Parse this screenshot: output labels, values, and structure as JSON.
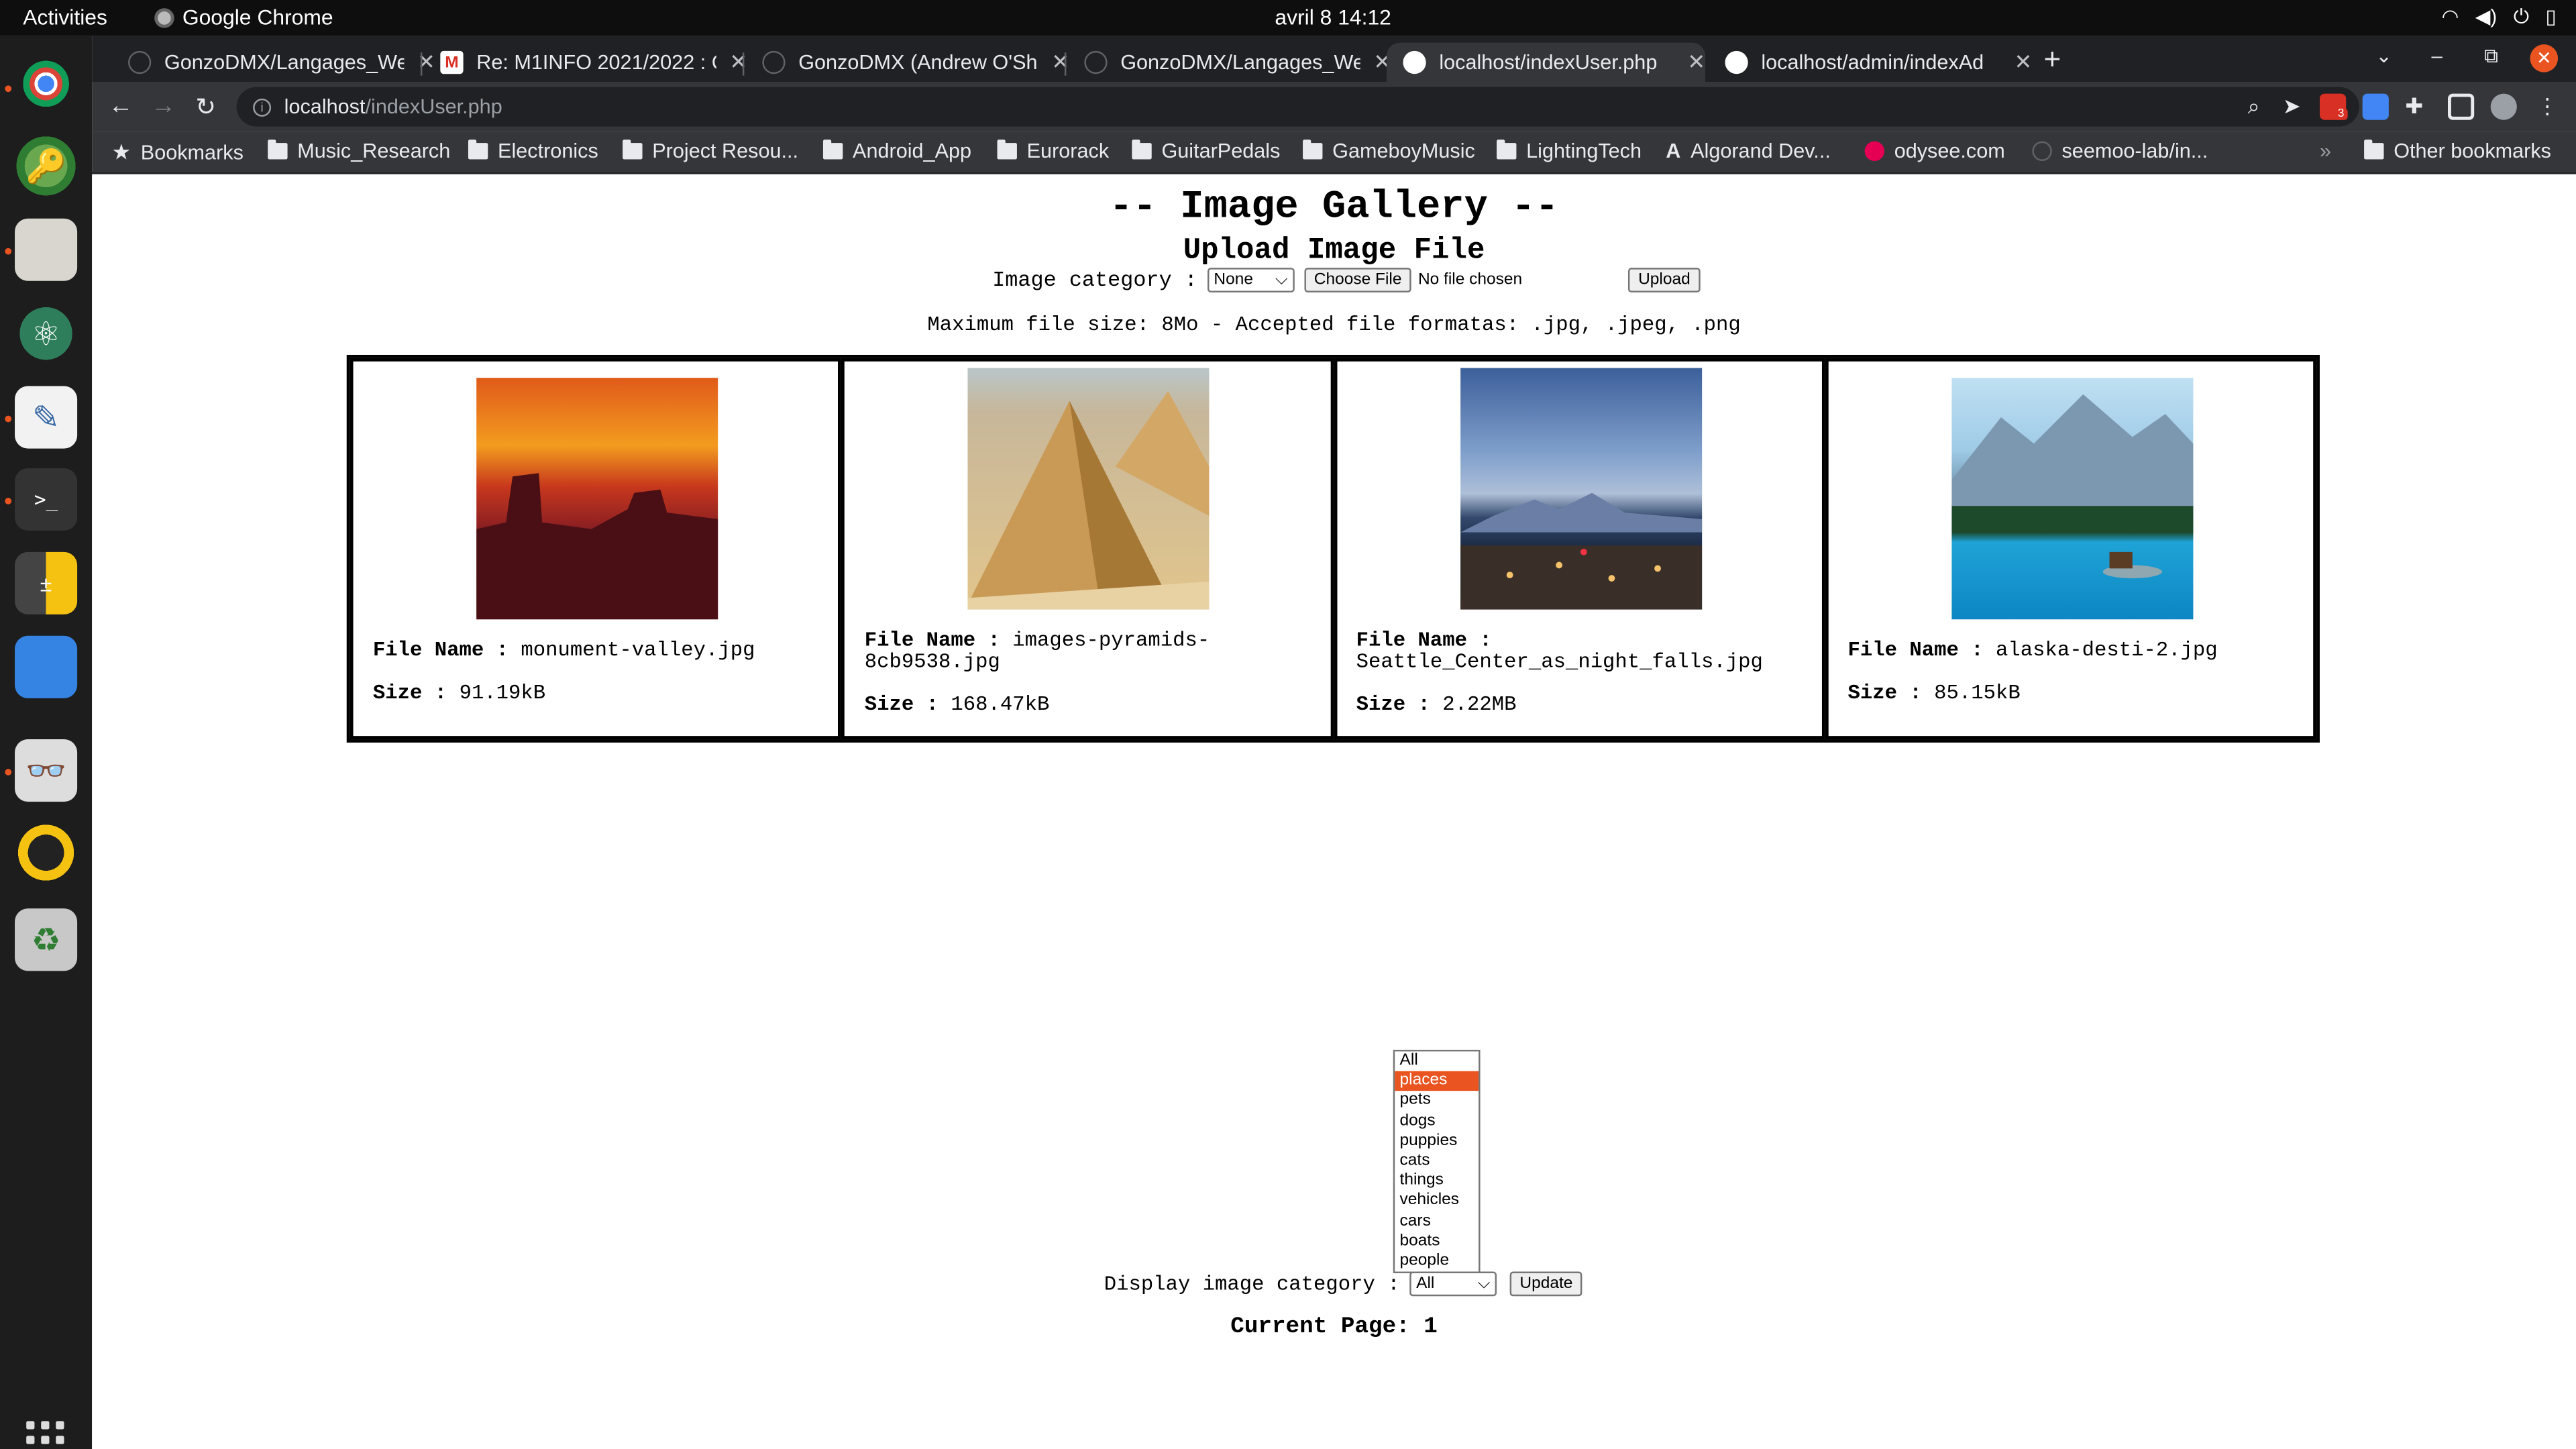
{
  "system": {
    "activities": "Activities",
    "app_name": "Google Chrome",
    "clock": "avril 8  14:12"
  },
  "tabs": [
    {
      "title": "GonzoDMX/Langages_We",
      "icon": "github-icon"
    },
    {
      "title": "Re: M1INFO 2021/2022 : C",
      "icon": "gmail-icon"
    },
    {
      "title": "GonzoDMX (Andrew O'Sh",
      "icon": "github-icon"
    },
    {
      "title": "GonzoDMX/Langages_We",
      "icon": "github-icon"
    },
    {
      "title": "localhost/indexUser.php",
      "icon": "globe-icon"
    },
    {
      "title": "localhost/admin/indexAd",
      "icon": "globe-icon"
    }
  ],
  "address": {
    "host": "localhost",
    "path": "/indexUser.php"
  },
  "bookmarks": [
    {
      "label": "Bookmarks",
      "icon": "star-icon"
    },
    {
      "label": "Music_Research",
      "icon": "folder-icon"
    },
    {
      "label": "Electronics",
      "icon": "folder-icon"
    },
    {
      "label": "Project Resou...",
      "icon": "folder-icon"
    },
    {
      "label": "Android_App",
      "icon": "folder-icon"
    },
    {
      "label": "Eurorack",
      "icon": "folder-icon"
    },
    {
      "label": "GuitarPedals",
      "icon": "folder-icon"
    },
    {
      "label": "GameboyMusic",
      "icon": "folder-icon"
    },
    {
      "label": "LightingTech",
      "icon": "folder-icon"
    },
    {
      "label": "Algorand Dev...",
      "icon": "algorand-icon"
    },
    {
      "label": "odysee.com",
      "icon": "odysee-icon"
    },
    {
      "label": "seemoo-lab/in...",
      "icon": "github-icon"
    }
  ],
  "other_bookmarks": "Other bookmarks",
  "extension_badge": "3",
  "page": {
    "title": "-- Image Gallery --",
    "upload_heading": "Upload Image File",
    "category_label": "Image category :",
    "category_value": "None",
    "choose_file": "Choose File",
    "no_file": "No file chosen",
    "upload_button": "Upload",
    "limits": "Maximum file size: 8Mo - Accepted file formatas: .jpg, .jpeg, .png",
    "images": [
      {
        "name_label": "File Name :",
        "name": "monument-valley.jpg",
        "size_label": "Size :",
        "size": "91.19kB"
      },
      {
        "name_label": "File Name :",
        "name": "images-pyramids-8cb9538.jpg",
        "size_label": "Size :",
        "size": "168.47kB"
      },
      {
        "name_label": "File Name :",
        "name": "Seattle_Center_as_night_falls.jpg",
        "size_label": "Size :",
        "size": "2.22MB"
      },
      {
        "name_label": "File Name :",
        "name": "alaska-desti-2.jpg",
        "size_label": "Size :",
        "size": "85.15kB"
      }
    ],
    "display_label": "Display image category :",
    "display_value": "All",
    "update_button": "Update",
    "current_page": "Current Page: 1",
    "category_options": [
      "All",
      "places",
      "pets",
      "dogs",
      "puppies",
      "cats",
      "things",
      "vehicles",
      "cars",
      "boats",
      "people"
    ],
    "highlighted_option": "places"
  },
  "colors": {
    "accent": "#e95420",
    "chrome_dark": "#202124",
    "chrome_toolbar": "#35363a"
  }
}
